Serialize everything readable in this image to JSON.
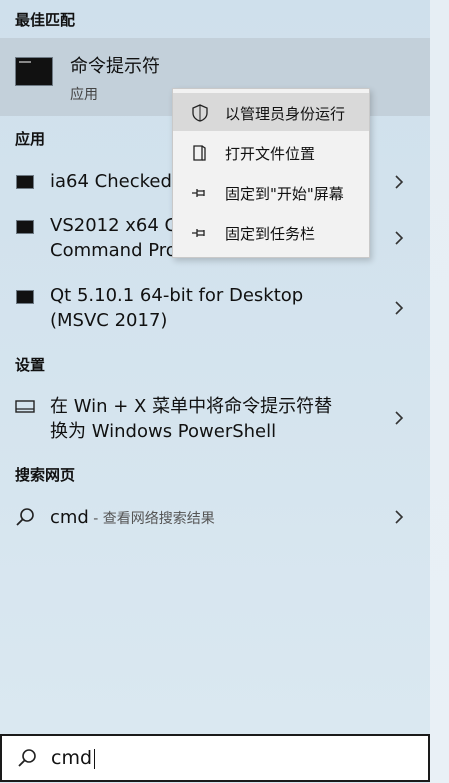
{
  "sections": {
    "best_match": "最佳匹配",
    "apps": "应用",
    "settings": "设置",
    "web": "搜索网页"
  },
  "best_match": {
    "title": "命令提示符",
    "subtitle": "应用"
  },
  "apps": [
    {
      "line1": "ia64 Checked",
      "line2": ""
    },
    {
      "line1": "VS2012 x64 C",
      "line2": "Command Pro"
    },
    {
      "line1": "Qt 5.10.1 64-bit for Desktop",
      "line2": "(MSVC 2017)"
    }
  ],
  "settings_item": {
    "line1": "在 Win + X 菜单中将命令提示符替",
    "line2": "换为 Windows PowerShell"
  },
  "web_item": {
    "query": "cmd",
    "note": " - 查看网络搜索结果"
  },
  "context_menu": [
    {
      "label": "以管理员身份运行",
      "icon": "shield-icon"
    },
    {
      "label": "打开文件位置",
      "icon": "folder-location-icon"
    },
    {
      "label": "固定到\"开始\"屏幕",
      "icon": "pin-icon"
    },
    {
      "label": "固定到任务栏",
      "icon": "pin-icon"
    }
  ],
  "search": {
    "value": "cmd"
  },
  "colors": {
    "highlight": "#c3d0da",
    "menu_bg": "#f2f2f2",
    "menu_hover": "#d9d9d9"
  }
}
